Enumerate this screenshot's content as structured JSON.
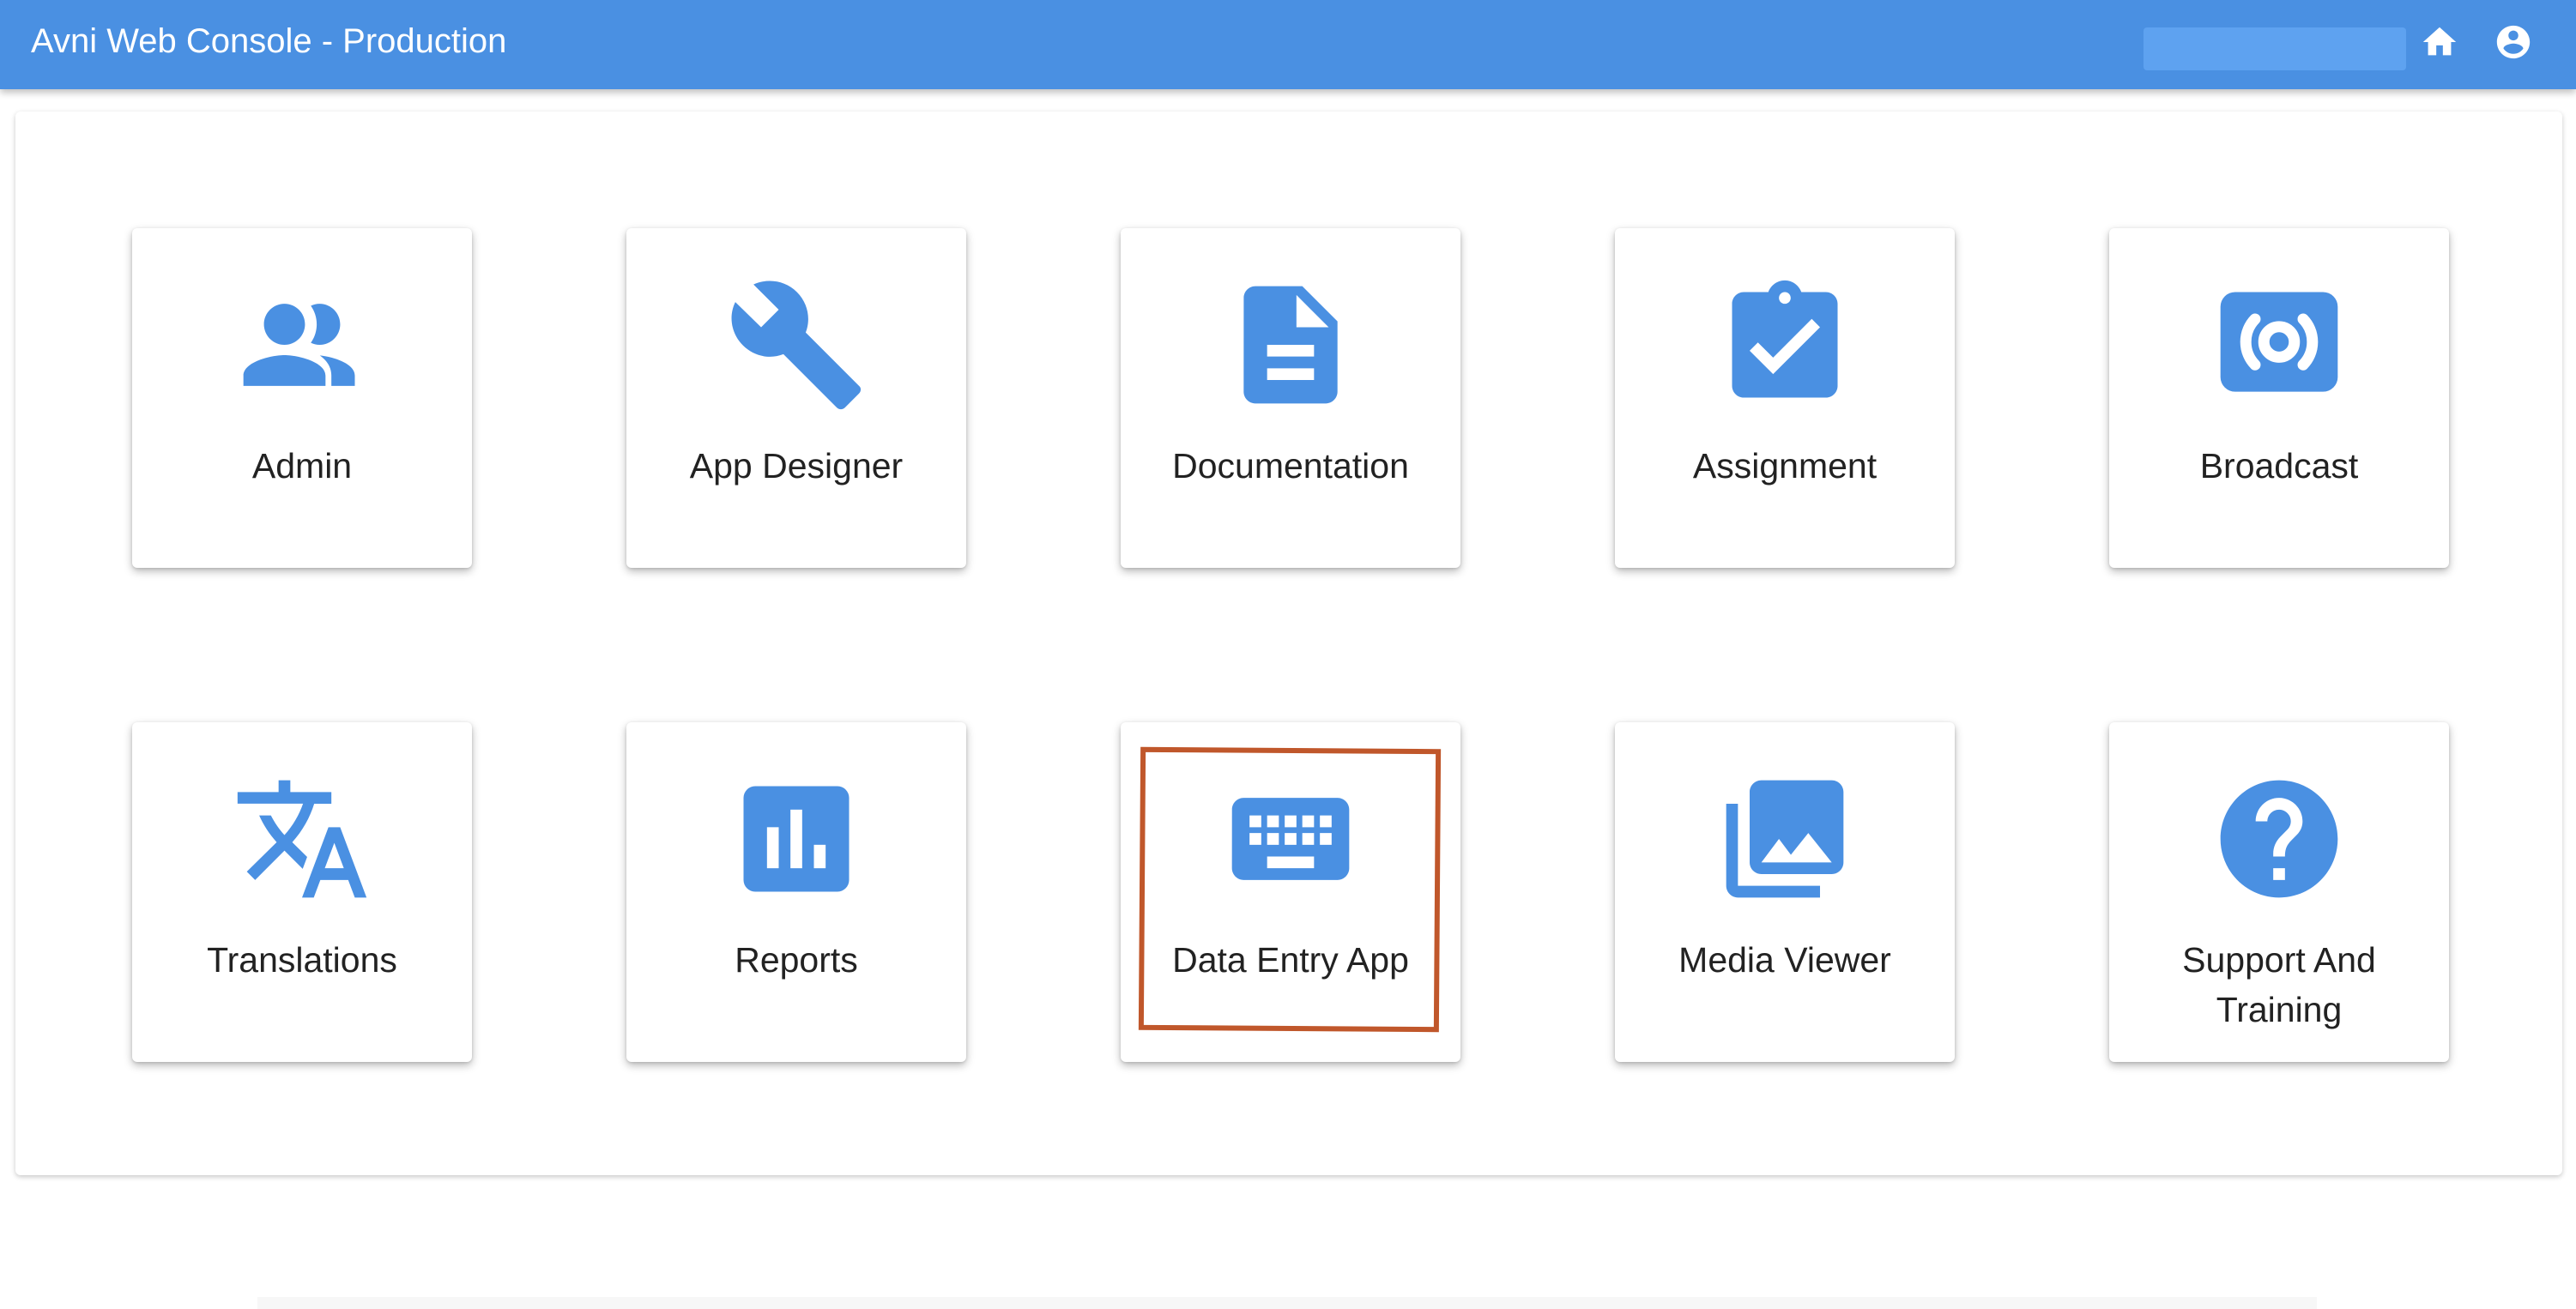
{
  "appbar": {
    "title": "Avni Web Console - Production",
    "background_color": "#4a90e2",
    "icons": [
      "home-icon",
      "account-circle-icon"
    ]
  },
  "tiles": [
    {
      "label": "Admin",
      "icon": "people-icon"
    },
    {
      "label": "App Designer",
      "icon": "wrench-icon"
    },
    {
      "label": "Documentation",
      "icon": "document-icon"
    },
    {
      "label": "Assignment",
      "icon": "assignment-check-icon"
    },
    {
      "label": "Broadcast",
      "icon": "broadcast-icon"
    },
    {
      "label": "Translations",
      "icon": "translate-icon"
    },
    {
      "label": "Reports",
      "icon": "bar-chart-icon"
    },
    {
      "label": "Data Entry App",
      "icon": "keyboard-icon"
    },
    {
      "label": "Media Viewer",
      "icon": "photo-library-icon"
    },
    {
      "label": "Support And Training",
      "icon": "help-icon"
    }
  ],
  "colors": {
    "icon": "#4a90e2",
    "label": "#222222",
    "highlight": "#c0572b"
  }
}
